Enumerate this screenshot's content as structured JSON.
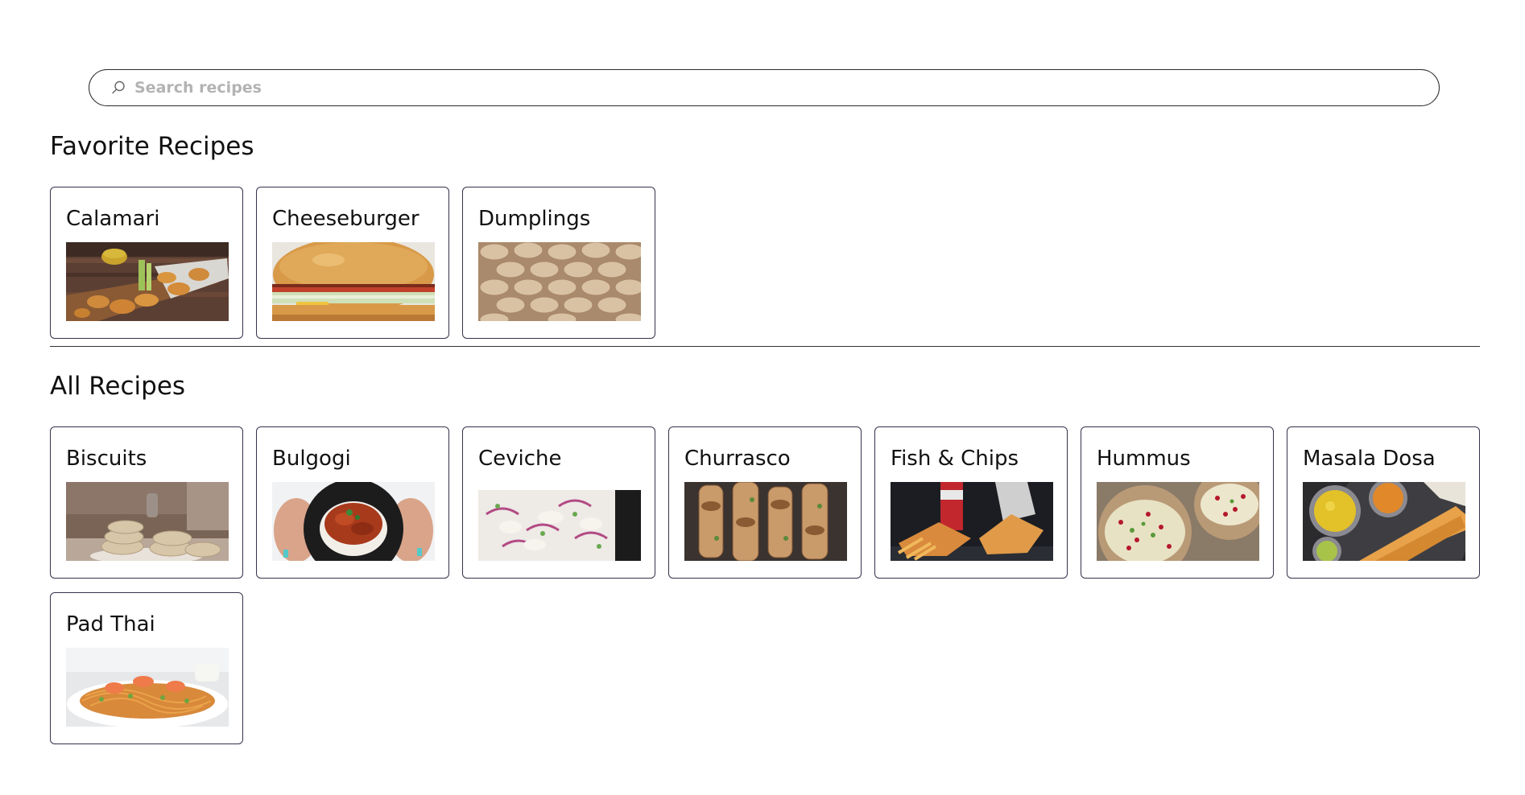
{
  "search": {
    "placeholder": "Search recipes",
    "value": ""
  },
  "favorites": {
    "title": "Favorite Recipes",
    "items": [
      {
        "name": "Calamari",
        "image": "calamari-photo"
      },
      {
        "name": "Cheeseburger",
        "image": "cheeseburger-photo"
      },
      {
        "name": "Dumplings",
        "image": "dumplings-photo"
      }
    ]
  },
  "all": {
    "title": "All Recipes",
    "items": [
      {
        "name": "Biscuits",
        "image": "biscuits-photo"
      },
      {
        "name": "Bulgogi",
        "image": "bulgogi-photo"
      },
      {
        "name": "Ceviche",
        "image": "ceviche-photo"
      },
      {
        "name": "Churrasco",
        "image": "churrasco-photo"
      },
      {
        "name": "Fish & Chips",
        "image": "fish-and-chips-photo"
      },
      {
        "name": "Hummus",
        "image": "hummus-photo"
      },
      {
        "name": "Masala Dosa",
        "image": "masala-dosa-photo"
      },
      {
        "name": "Pad Thai",
        "image": "pad-thai-photo"
      }
    ]
  }
}
